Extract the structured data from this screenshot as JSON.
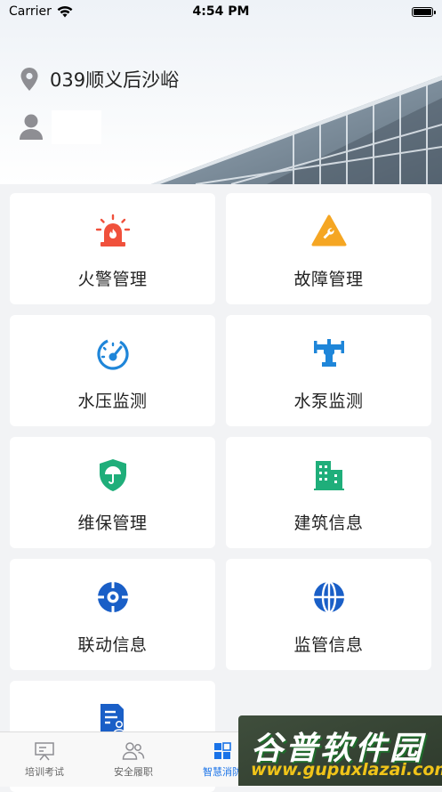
{
  "status_bar": {
    "carrier": "Carrier",
    "time": "4:54 PM"
  },
  "header": {
    "location": "039顺义后沙峪"
  },
  "menu": [
    {
      "label": "火警管理",
      "icon": "fire-alarm-icon",
      "color": "#f0513c"
    },
    {
      "label": "故障管理",
      "icon": "fault-wrench-icon",
      "color": "#f5a623"
    },
    {
      "label": "水压监测",
      "icon": "pressure-gauge-icon",
      "color": "#1f86d9"
    },
    {
      "label": "水泵监测",
      "icon": "water-pump-icon",
      "color": "#1f86d9"
    },
    {
      "label": "维保管理",
      "icon": "maintenance-shield-icon",
      "color": "#1fae7a"
    },
    {
      "label": "建筑信息",
      "icon": "building-icon",
      "color": "#1fae7a"
    },
    {
      "label": "联动信息",
      "icon": "linkage-target-icon",
      "color": "#1a5fc7"
    },
    {
      "label": "监管信息",
      "icon": "supervision-globe-icon",
      "color": "#1a5fc7"
    },
    {
      "label": "",
      "icon": "document-user-icon",
      "color": "#1a5fc7"
    }
  ],
  "tabs": [
    {
      "label": "培训考试",
      "icon": "training-board-icon",
      "active": false
    },
    {
      "label": "安全履职",
      "icon": "users-icon",
      "active": false
    },
    {
      "label": "智慧消防",
      "icon": "grid-apps-icon",
      "active": true
    }
  ],
  "watermark": {
    "text": "谷普软件园",
    "url": "www.gupuxlazai.com"
  }
}
